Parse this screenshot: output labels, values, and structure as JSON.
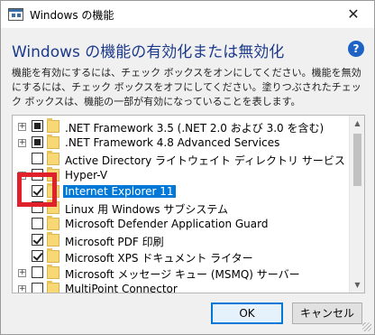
{
  "window": {
    "title": "Windows の機能",
    "close_glyph": "✕"
  },
  "heading": "Windows の機能の有効化または無効化",
  "help": {
    "glyph": "?"
  },
  "description": "機能を有効にするには、チェック ボックスをオンにしてください。機能を無効にするには、チェック ボックスをオフにしてください。塗りつぶされたチェック ボックスは、機能の一部が有効になっていることを表します。",
  "features": [
    {
      "label": ".NET Framework 3.5 (.NET 2.0 および 3.0 を含む)",
      "state": "partial",
      "expandable": true,
      "selected": false
    },
    {
      "label": ".NET Framework 4.8 Advanced Services",
      "state": "partial",
      "expandable": true,
      "selected": false
    },
    {
      "label": "Active Directory ライトウェイト ディレクトリ サービス",
      "state": "unchecked",
      "expandable": false,
      "selected": false
    },
    {
      "label": "Hyper-V",
      "state": "unchecked",
      "expandable": true,
      "selected": false
    },
    {
      "label": "Internet Explorer 11",
      "state": "checked",
      "expandable": false,
      "selected": true
    },
    {
      "label": "Linux 用 Windows サブシステム",
      "state": "unchecked",
      "expandable": false,
      "selected": false
    },
    {
      "label": "Microsoft Defender Application Guard",
      "state": "unchecked",
      "expandable": false,
      "selected": false
    },
    {
      "label": "Microsoft PDF 印刷",
      "state": "checked",
      "expandable": false,
      "selected": false
    },
    {
      "label": "Microsoft XPS ドキュメント ライター",
      "state": "checked",
      "expandable": false,
      "selected": false
    },
    {
      "label": "Microsoft メッセージ キュー (MSMQ) サーバー",
      "state": "unchecked",
      "expandable": true,
      "selected": false
    },
    {
      "label": "MultiPoint Connector",
      "state": "unchecked",
      "expandable": true,
      "selected": false
    }
  ],
  "buttons": {
    "ok": "OK",
    "cancel": "キャンセル"
  },
  "colors": {
    "heading": "#1c3a8a",
    "selection": "#0078d7",
    "highlight_box": "#e0202a",
    "folder": "#f8d775"
  }
}
